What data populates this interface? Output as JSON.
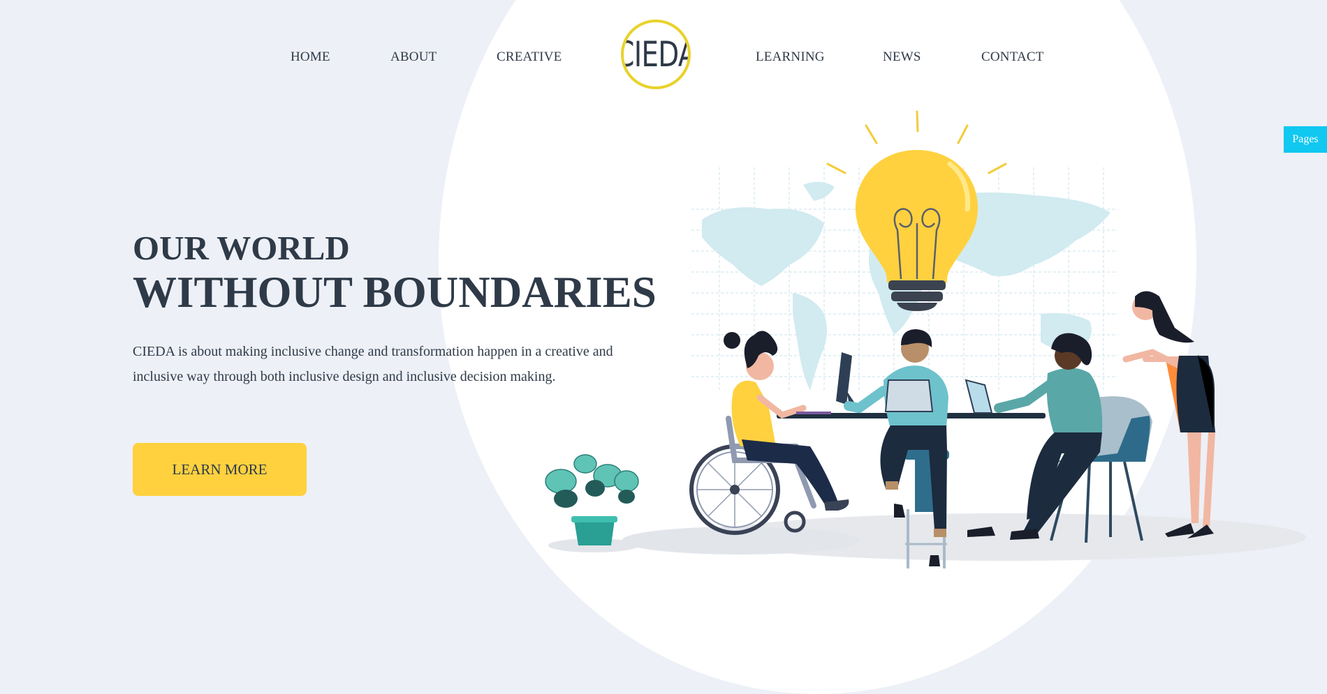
{
  "nav": {
    "items": [
      {
        "label": "HOME"
      },
      {
        "label": "ABOUT"
      },
      {
        "label": "CREATIVE"
      },
      {
        "label": "LEARNING"
      },
      {
        "label": "NEWS"
      },
      {
        "label": "CONTACT"
      }
    ],
    "logo_text": "CIEDA"
  },
  "hero": {
    "title_line1": "OUR WORLD",
    "title_line2": "WITHOUT BOUNDARIES",
    "description": "CIEDA is about making inclusive change and transformation happen in a creative and inclusive way through both inclusive design and inclusive decision making.",
    "cta_label": "LEARN MORE"
  },
  "side_tab": {
    "label": "Pages"
  },
  "colors": {
    "background": "#edf0f7",
    "text": "#2f3a48",
    "accent_yellow": "#ffd13f",
    "logo_ring": "#e9d22b",
    "pages_tab": "#10c8f0"
  },
  "illustration": {
    "icons": [
      "light-bulb-icon",
      "world-map",
      "people-at-table",
      "potted-plant-icon",
      "wheelchair-icon"
    ]
  }
}
